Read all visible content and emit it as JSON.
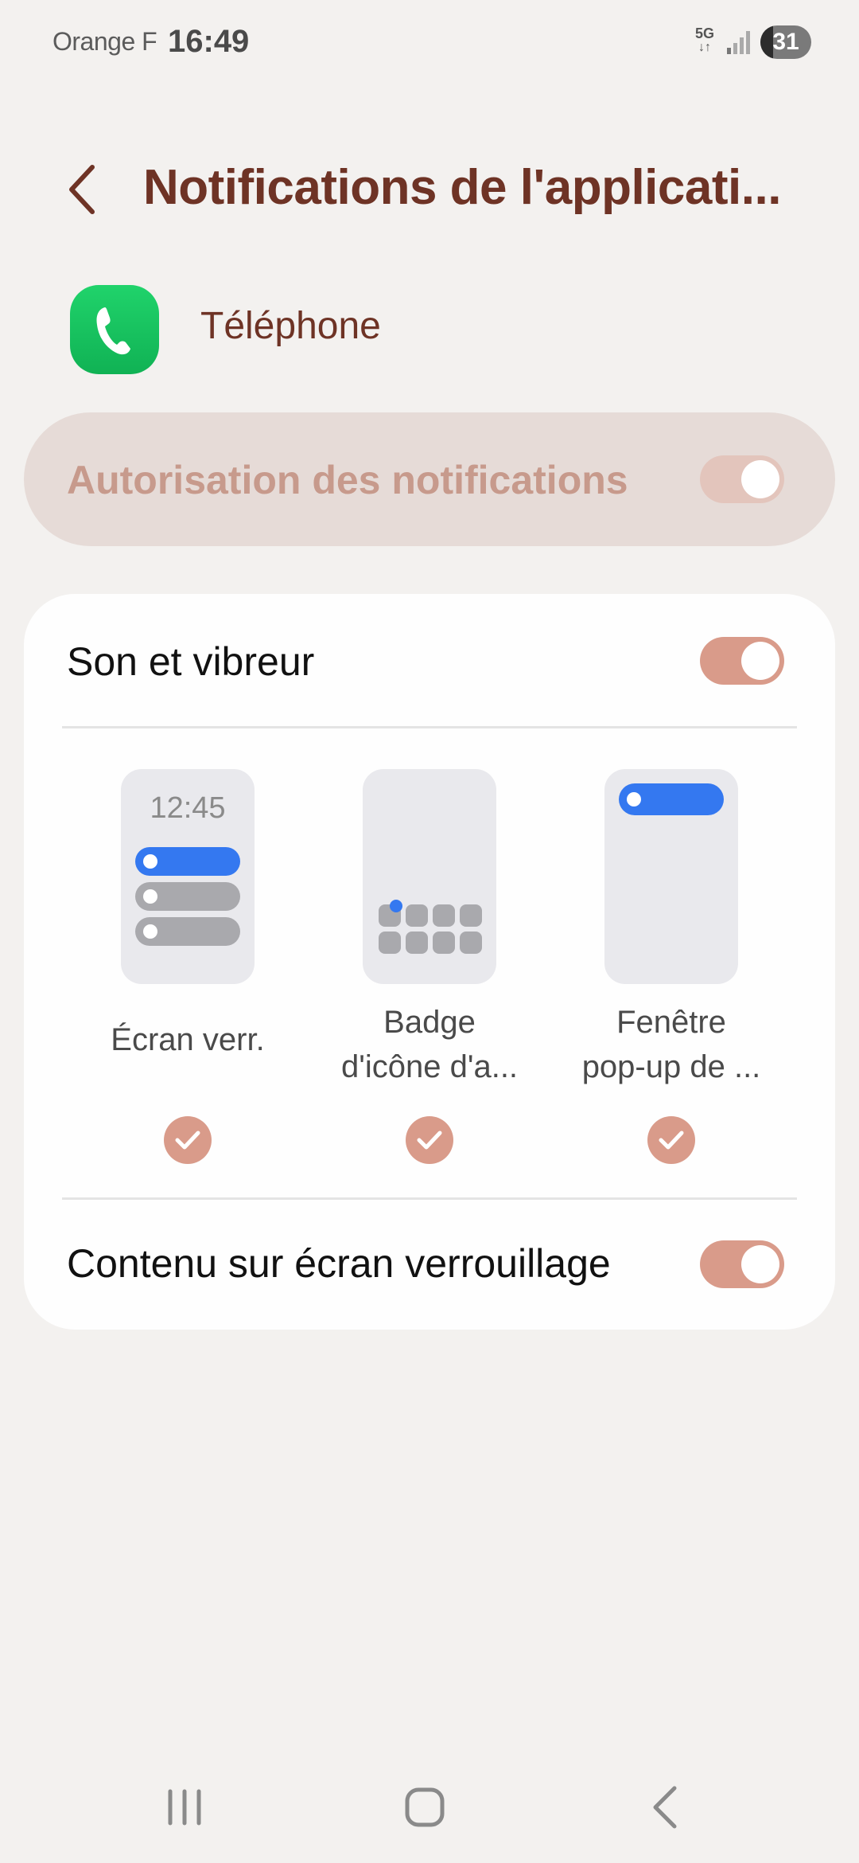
{
  "status_bar": {
    "carrier": "Orange F",
    "time": "16:49",
    "network": "5G",
    "battery": "31"
  },
  "header": {
    "title": "Notifications de l'applicati..."
  },
  "app": {
    "name": "Téléphone",
    "icon": "phone-icon"
  },
  "allow": {
    "label": "Autorisation des notifications",
    "enabled": true
  },
  "settings": {
    "sound": {
      "label": "Son et vibreur",
      "enabled": true
    },
    "options": [
      {
        "label": "Écran verr.",
        "preview_time": "12:45",
        "checked": true
      },
      {
        "label": "Badge\nd'icône d'a...",
        "checked": true
      },
      {
        "label": "Fenêtre\npop-up de ...",
        "checked": true
      }
    ],
    "lock_content": {
      "label": "Contenu sur écran verrouillage",
      "enabled": true
    }
  },
  "nav": {
    "recents": "recents-icon",
    "home": "home-icon",
    "back": "back-icon"
  },
  "colors": {
    "accent": "#d99b8a",
    "title": "#6e3325",
    "blue": "#3478f0",
    "green": "#16c25e"
  }
}
